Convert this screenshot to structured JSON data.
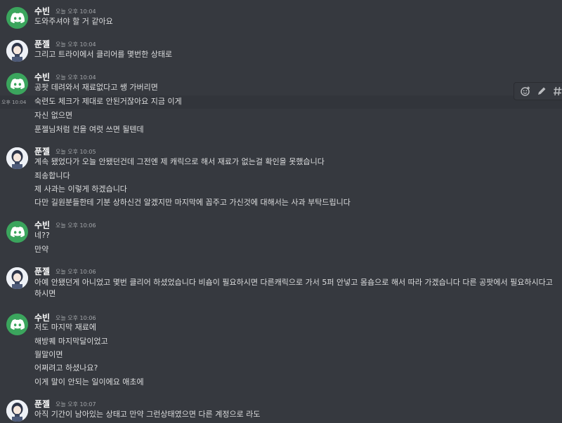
{
  "users": {
    "subin": "수빈",
    "punjel": "푼젤"
  },
  "messages": [
    {
      "author": "수빈",
      "time": "오늘 오후 10:04",
      "lines": [
        "도와주셔야 할 거 같아요"
      ]
    },
    {
      "author": "푼젤",
      "time": "오늘 오후 10:04",
      "lines": [
        "그리고 트라이에서 클리어를 몇번한 상태로"
      ]
    },
    {
      "author": "수빈",
      "time": "오늘 오후 10:04",
      "lines": [
        "공팟 데려와서 재료없다고 쌩 가버리면",
        "숙련도 체크가 제대로 안된거잖아요 지금 이게",
        "자신 없으면",
        "푼젤님처럼 컨을 여럿 쓰면 될텐데"
      ]
    },
    {
      "author": "푼젤",
      "time": "오늘 오후 10:05",
      "lines": [
        "계속 됐었다가 오늘 안됐던건데 그전엔 제 캐릭으로 해서 재료가 없는걸 확인을 못했습니다",
        "죄송합니다",
        "제 사과는 이렇게 하겠습니다",
        "다만 길원분들한테 기분 상하신건 알겠지만 마지막에 꼽주고 가신것에 대해서는 사과 부탁드립니다"
      ]
    },
    {
      "author": "수빈",
      "time": "오늘 오후 10:06",
      "lines": [
        "네??",
        "만약"
      ]
    },
    {
      "author": "푼젤",
      "time": "오늘 오후 10:06",
      "lines": [
        "아예 안됐던게 아니었고 몇번 클리어 하셨었습니다 비숍이 필요하시면 다른캐릭으로 가서 5퍼 안넣고 몸숍으로 해서 따라 가겠습니다 다른 공팟에서 필요하시다고 하시면"
      ]
    },
    {
      "author": "수빈",
      "time": "오늘 오후 10:06",
      "lines": [
        "저도 마지막 재료에",
        "해방퀘 마지막달이었고",
        "월말이면",
        "어쩌려고 하셨나요?",
        "이게 말이 안되는 일이에요 애초에"
      ]
    },
    {
      "author": "푼젤",
      "time": "오늘 오후 10:07",
      "lines": [
        "아직 기간이 남아있는 상태고 만약 그런상태였으면 다른 계정으로 라도"
      ]
    }
  ],
  "hover_timestamp": "오후 10:04",
  "toolbar": {
    "add_reaction_icon": "add-reaction-icon",
    "edit_icon": "pencil-icon",
    "thread_icon": "thread-icon"
  },
  "colors": {
    "background": "#36393f",
    "discord_green": "#3ba55d",
    "text": "#dcddde",
    "username": "#ffffff",
    "timestamp": "#a3a6aa"
  }
}
